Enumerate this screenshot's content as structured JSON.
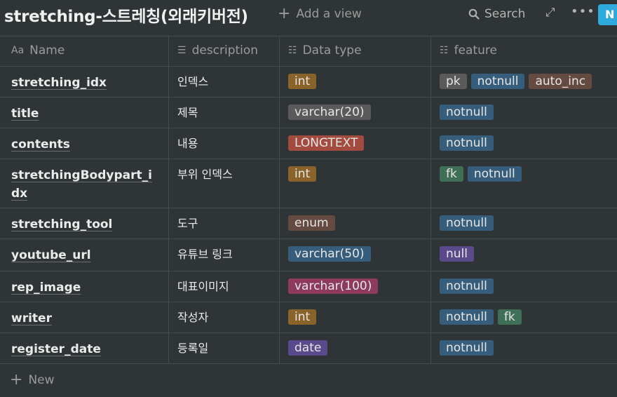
{
  "header": {
    "title": "stretching-스트레칭(외래키버전)",
    "add_view": "Add a view",
    "search": "Search",
    "new_button": "N"
  },
  "columns": [
    {
      "label": "Name",
      "icon": "text-aa-icon"
    },
    {
      "label": "description",
      "icon": "text-lines-icon"
    },
    {
      "label": "Data type",
      "icon": "list-icon"
    },
    {
      "label": "feature",
      "icon": "list-icon"
    }
  ],
  "rows": [
    {
      "name": "stretching_idx",
      "description": "인덱스",
      "type": {
        "label": "int",
        "style": "t-int"
      },
      "features": [
        {
          "label": "pk",
          "style": "t-pk"
        },
        {
          "label": "notnull",
          "style": "t-notnull"
        },
        {
          "label": "auto_inc",
          "style": "t-auto"
        }
      ]
    },
    {
      "name": "title",
      "description": "제목",
      "type": {
        "label": "varchar(20)",
        "style": "t-varchar20"
      },
      "features": [
        {
          "label": "notnull",
          "style": "t-notnull"
        }
      ]
    },
    {
      "name": "contents",
      "description": "내용",
      "type": {
        "label": "LONGTEXT",
        "style": "t-longtext"
      },
      "features": [
        {
          "label": "notnull",
          "style": "t-notnull"
        }
      ]
    },
    {
      "name": "stretchingBodypart_idx",
      "description": "부위 인덱스",
      "type": {
        "label": "int",
        "style": "t-int"
      },
      "features": [
        {
          "label": "fk",
          "style": "t-fk"
        },
        {
          "label": "notnull",
          "style": "t-notnull"
        }
      ]
    },
    {
      "name": "stretching_tool",
      "description": "도구",
      "type": {
        "label": "enum",
        "style": "t-enum"
      },
      "features": [
        {
          "label": "notnull",
          "style": "t-notnull"
        }
      ]
    },
    {
      "name": "youtube_url",
      "description": "유튜브 링크",
      "type": {
        "label": "varchar(50)",
        "style": "t-varchar50"
      },
      "features": [
        {
          "label": "null",
          "style": "t-null"
        }
      ]
    },
    {
      "name": "rep_image",
      "description": "대표이미지",
      "type": {
        "label": "varchar(100)",
        "style": "t-varchar100"
      },
      "features": [
        {
          "label": "notnull",
          "style": "t-notnull"
        }
      ]
    },
    {
      "name": "writer",
      "description": "작성자",
      "type": {
        "label": "int",
        "style": "t-int"
      },
      "features": [
        {
          "label": "notnull",
          "style": "t-notnull"
        },
        {
          "label": "fk",
          "style": "t-fk"
        }
      ]
    },
    {
      "name": "register_date",
      "description": "등록일",
      "type": {
        "label": "date",
        "style": "t-date"
      },
      "features": [
        {
          "label": "notnull",
          "style": "t-notnull"
        }
      ]
    }
  ],
  "footer": {
    "new_label": "New"
  }
}
